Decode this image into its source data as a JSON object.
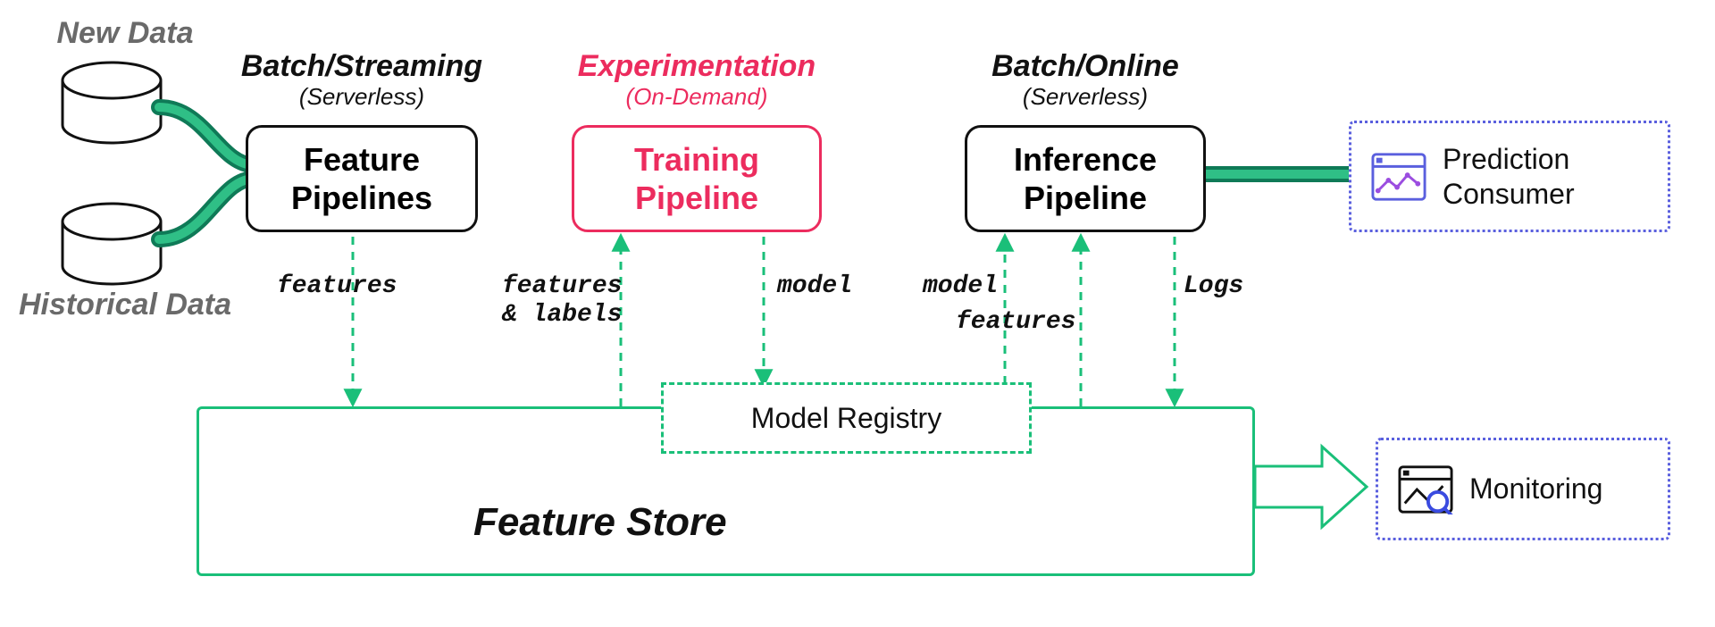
{
  "sources": {
    "new_data": "New Data",
    "historical_data": "Historical Data"
  },
  "headers": {
    "batch_streaming": {
      "line1": "Batch/Streaming",
      "line2": "(Serverless)"
    },
    "experimentation": {
      "line1": "Experimentation",
      "line2": "(On-Demand)"
    },
    "batch_online": {
      "line1": "Batch/Online",
      "line2": "(Serverless)"
    }
  },
  "pipelines": {
    "feature": "Feature\nPipelines",
    "training": "Training\nPipeline",
    "inference": "Inference\nPipeline"
  },
  "feature_store": {
    "title": "Feature Store",
    "model_registry": "Model Registry"
  },
  "consumers": {
    "prediction": "Prediction\nConsumer",
    "monitoring": "Monitoring"
  },
  "edges": {
    "features": "features",
    "features_labels": "features\n& labels",
    "model_to_registry": "model",
    "model_to_inference": "model",
    "features_to_inference": "features",
    "logs": "Logs"
  },
  "colors": {
    "green": "#1abf79",
    "green_dark": "#0f7a57",
    "pink": "#ec2c5e",
    "grey": "#6a6a6a",
    "black": "#111111",
    "blue": "#5a5fde",
    "purple": "#9b4de0"
  }
}
